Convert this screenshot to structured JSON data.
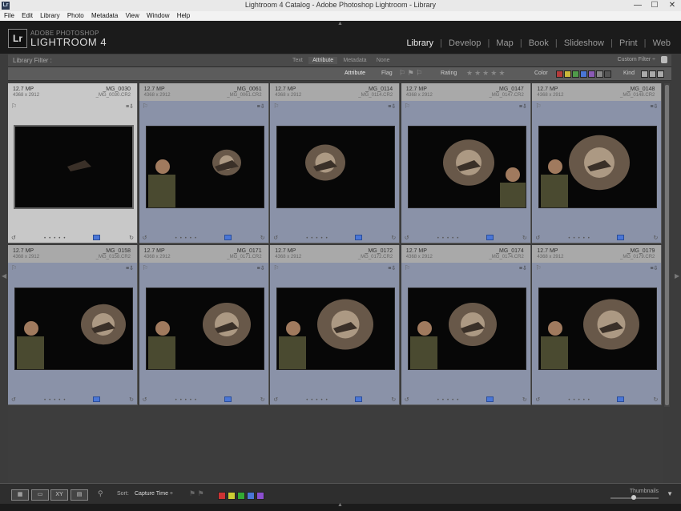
{
  "window": {
    "title": "Lightroom 4 Catalog - Adobe Photoshop Lightroom - Library",
    "app_icon": "Lr",
    "minimize_glyph": "—",
    "maximize_glyph": "☐",
    "close_glyph": "✕"
  },
  "menu": [
    "File",
    "Edit",
    "Library",
    "Photo",
    "Metadata",
    "View",
    "Window",
    "Help"
  ],
  "identity": {
    "logo": "Lr",
    "subtitle": "ADOBE PHOTOSHOP",
    "product": "LIGHTROOM 4"
  },
  "modules": {
    "items": [
      "Library",
      "Develop",
      "Map",
      "Book",
      "Slideshow",
      "Print",
      "Web"
    ],
    "active": "Library",
    "separator": "|"
  },
  "library_filter": {
    "label": "Library Filter :",
    "tabs": [
      "Text",
      "Attribute",
      "Metadata",
      "None"
    ],
    "selected_tab": "Attribute",
    "preset": "Custom Filter ÷"
  },
  "attribute_bar": {
    "label": "Attribute",
    "flag_label": "Flag",
    "rating_label": "Rating",
    "color_label": "Color",
    "kind_label": "Kind",
    "color_swatches": [
      "#b33a3a",
      "#c9b73a",
      "#4f9a4a",
      "#4a76d6",
      "#8b5ab5",
      "#888888",
      "#555555"
    ]
  },
  "thumbnails": [
    {
      "mp": "12.7 MP",
      "dim": "4368 x 2912",
      "name": "_MG_0030",
      "fname": "_MG_0030.CR2",
      "selected": true
    },
    {
      "mp": "12.7 MP",
      "dim": "4368 x 2912",
      "name": "_MG_0061",
      "fname": "_MG_0061.CR2"
    },
    {
      "mp": "12.7 MP",
      "dim": "4368 x 2912",
      "name": "_MG_0114",
      "fname": "_MG_0114.CR2"
    },
    {
      "mp": "12.7 MP",
      "dim": "4368 x 2912",
      "name": "_MG_0147",
      "fname": "_MG_0147.CR2"
    },
    {
      "mp": "12.7 MP",
      "dim": "4368 x 2912",
      "name": "_MG_0148",
      "fname": "_MG_0148.CR2"
    },
    {
      "mp": "12.7 MP",
      "dim": "4368 x 2912",
      "name": "_MG_0158",
      "fname": "_MG_0158.CR2"
    },
    {
      "mp": "12.7 MP",
      "dim": "4368 x 2912",
      "name": "_MG_0171",
      "fname": "_MG_0171.CR2"
    },
    {
      "mp": "12.7 MP",
      "dim": "4368 x 2912",
      "name": "_MG_0172",
      "fname": "_MG_0172.CR2"
    },
    {
      "mp": "12.7 MP",
      "dim": "4368 x 2912",
      "name": "_MG_0174",
      "fname": "_MG_0174.CR2"
    },
    {
      "mp": "12.7 MP",
      "dim": "4368 x 2912",
      "name": "_MG_0179",
      "fname": "_MG_0179.CR2"
    }
  ],
  "toolbar": {
    "sort_label": "Sort:",
    "sort_value": "Capture Time ÷",
    "thumbnails_label": "Thumbnails",
    "compare_label": "XY",
    "label_colors": [
      "#c33",
      "#cc3",
      "#3a3",
      "#4a76d6",
      "#8b4fcf"
    ]
  },
  "icons": {
    "grid_view": "grid-view-icon",
    "loupe_view": "loupe-view-icon",
    "compare_view": "compare-view-icon",
    "survey_view": "survey-view-icon",
    "painter": "painter-icon",
    "flag": "flag-icon",
    "metadata_badge": "metadata-badge-icon",
    "rotate_left": "rotate-left-icon",
    "rotate_right": "rotate-right-icon"
  }
}
